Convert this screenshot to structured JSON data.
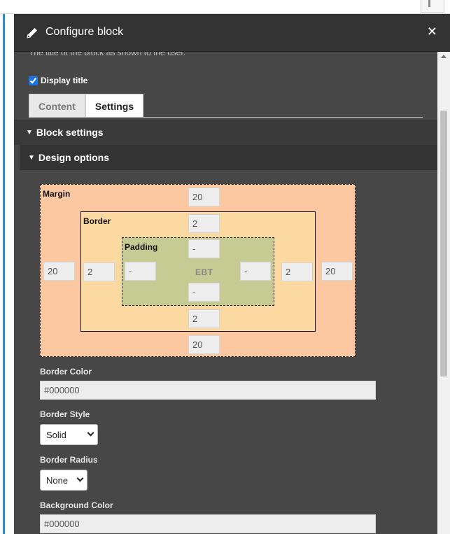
{
  "dialog": {
    "title": "Configure block",
    "close_symbol": "✕",
    "icons": {
      "edit": "pencil-icon",
      "close": "close-icon"
    }
  },
  "form": {
    "cut_text": "The title of the block as shown to the user.",
    "display_title_label": "Display title",
    "display_title_checked": true
  },
  "tabs": [
    {
      "label": "Content",
      "active": false
    },
    {
      "label": "Settings",
      "active": true
    }
  ],
  "sections": {
    "block_settings": "Block settings",
    "design_options": "Design options",
    "expand_symbol": "▼"
  },
  "box_model": {
    "margin": {
      "label": "Margin",
      "top": "20",
      "right": "20",
      "bottom": "20",
      "left": "20"
    },
    "border": {
      "label": "Border",
      "top": "2",
      "right": "2",
      "bottom": "2",
      "left": "2"
    },
    "padding": {
      "label": "Padding",
      "top": "-",
      "right": "-",
      "bottom": "-",
      "left": "-"
    },
    "center_label": "EBT"
  },
  "fields": {
    "border_color": {
      "label": "Border Color",
      "value": "#000000"
    },
    "border_style": {
      "label": "Border Style",
      "value": "Solid"
    },
    "border_radius": {
      "label": "Border Radius",
      "value": "None"
    },
    "background_color": {
      "label": "Background Color",
      "value": "#000000"
    }
  },
  "colors": {
    "titlebar": "#333333",
    "panel": "#474747",
    "margin": "#fcc8a2",
    "border": "#fdd9a2",
    "padding": "#c6cb94",
    "accent": "#2a8fd0"
  }
}
